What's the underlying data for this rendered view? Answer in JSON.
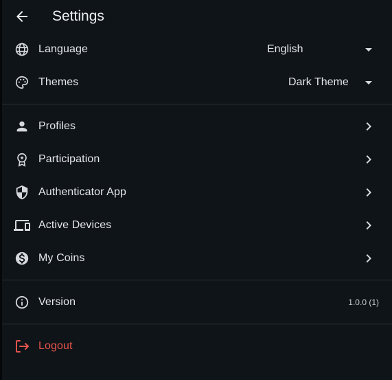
{
  "header": {
    "title": "Settings",
    "back_icon": "arrow-back-icon"
  },
  "preferences": {
    "language": {
      "label": "Language",
      "icon": "globe-icon",
      "value": "English"
    },
    "themes": {
      "label": "Themes",
      "icon": "palette-icon",
      "value": "Dark Theme"
    }
  },
  "menu": {
    "profiles": {
      "label": "Profiles",
      "icon": "person-icon"
    },
    "participation": {
      "label": "Participation",
      "icon": "award-icon"
    },
    "authenticator": {
      "label": "Authenticator App",
      "icon": "shield-icon"
    },
    "devices": {
      "label": "Active Devices",
      "icon": "devices-icon"
    },
    "coins": {
      "label": "My Coins",
      "icon": "coin-icon"
    }
  },
  "about": {
    "version": {
      "label": "Version",
      "icon": "info-icon",
      "value": "1.0.0 (1)"
    }
  },
  "logout": {
    "label": "Logout",
    "icon": "logout-icon"
  },
  "colors": {
    "background": "#0f1418",
    "text": "#e6e8ea",
    "icon": "#d5d9dc",
    "divider": "#2b3136",
    "danger": "#e5534b"
  }
}
